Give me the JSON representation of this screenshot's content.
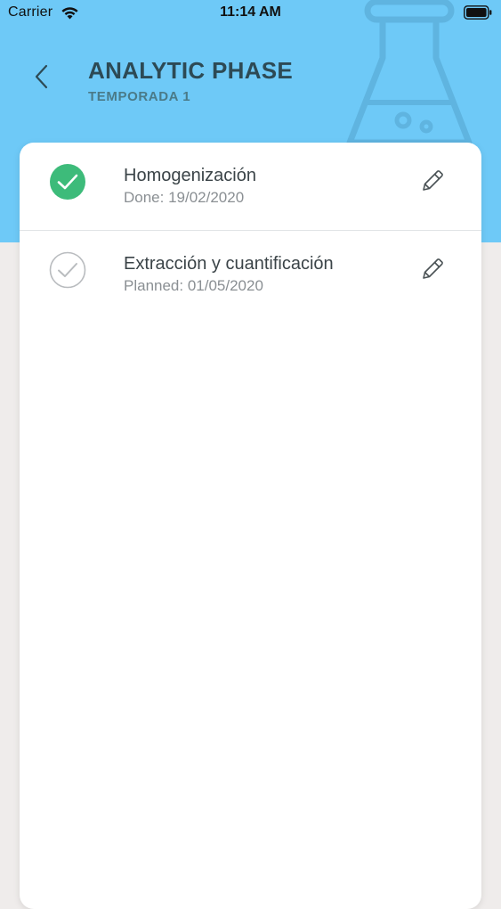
{
  "status_bar": {
    "carrier": "Carrier",
    "time": "11:14 AM",
    "wifi_icon": "wifi-icon",
    "battery_icon": "battery-icon"
  },
  "header": {
    "title": "ANALYTIC PHASE",
    "subtitle": "TEMPORADA 1",
    "back_icon": "chevron-left-icon",
    "background_icon": "flask-icon",
    "background_color": "#6ec9f7"
  },
  "phases": [
    {
      "name": "Homogenización",
      "date_text": "Done: 19/02/2020",
      "status": "done",
      "status_icon": "check-circle-filled-icon",
      "edit_icon": "pencil-icon"
    },
    {
      "name": "Extracción y cuantificación",
      "date_text": "Planned: 01/05/2020",
      "status": "planned",
      "status_icon": "check-circle-outline-icon",
      "edit_icon": "pencil-icon"
    }
  ],
  "colors": {
    "done_green": "#3dbb7a",
    "planned_gray": "#b9bcbf",
    "title_color": "#2d4a55"
  }
}
